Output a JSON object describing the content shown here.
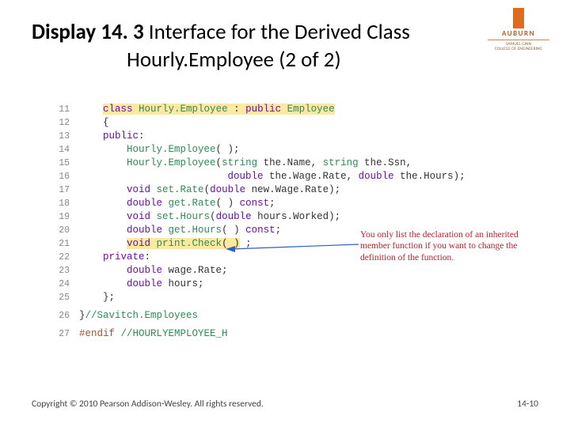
{
  "title": {
    "label": "Display 14. 3",
    "line1_rest": "  Interface for the Derived Class",
    "line2": "Hourly.Employee (2 of 2)"
  },
  "logo": {
    "name": "AUBURN",
    "sub1": "SAMUEL GINN",
    "sub2": "COLLEGE OF ENGINEERING"
  },
  "code": {
    "lines": [
      {
        "n": "11",
        "tokens": [
          {
            "t": "    ",
            "c": ""
          },
          {
            "t": "class",
            "c": "kw hl"
          },
          {
            "t": " ",
            "c": "hl"
          },
          {
            "t": "Hourly.Employee",
            "c": "ident hl"
          },
          {
            "t": " : ",
            "c": "hl sym"
          },
          {
            "t": "public",
            "c": "kw hl"
          },
          {
            "t": " ",
            "c": "hl"
          },
          {
            "t": "Employee",
            "c": "ident hl"
          }
        ]
      },
      {
        "n": "12",
        "tokens": [
          {
            "t": "    {",
            "c": "sym"
          }
        ]
      },
      {
        "n": "13",
        "tokens": [
          {
            "t": "    ",
            "c": ""
          },
          {
            "t": "public",
            "c": "kw"
          },
          {
            "t": ":",
            "c": "sym"
          }
        ]
      },
      {
        "n": "14",
        "tokens": [
          {
            "t": "        ",
            "c": ""
          },
          {
            "t": "Hourly.Employee",
            "c": "func"
          },
          {
            "t": "( );",
            "c": "sym"
          }
        ]
      },
      {
        "n": "15",
        "tokens": [
          {
            "t": "        ",
            "c": ""
          },
          {
            "t": "Hourly.Employee",
            "c": "func"
          },
          {
            "t": "(",
            "c": "sym"
          },
          {
            "t": "string",
            "c": "typegreen"
          },
          {
            "t": " the.Name, ",
            "c": "sym"
          },
          {
            "t": "string",
            "c": "typegreen"
          },
          {
            "t": " the.Ssn,",
            "c": "sym"
          }
        ]
      },
      {
        "n": "16",
        "tokens": [
          {
            "t": "                         ",
            "c": ""
          },
          {
            "t": "double",
            "c": "kw"
          },
          {
            "t": " the.Wage.Rate, ",
            "c": "sym"
          },
          {
            "t": "double",
            "c": "kw"
          },
          {
            "t": " the.Hours);",
            "c": "sym"
          }
        ]
      },
      {
        "n": "17",
        "tokens": [
          {
            "t": "        ",
            "c": ""
          },
          {
            "t": "void",
            "c": "kw"
          },
          {
            "t": " ",
            "c": ""
          },
          {
            "t": "set.Rate",
            "c": "func"
          },
          {
            "t": "(",
            "c": "sym"
          },
          {
            "t": "double",
            "c": "kw"
          },
          {
            "t": " new.Wage.Rate);",
            "c": "sym"
          }
        ]
      },
      {
        "n": "18",
        "tokens": [
          {
            "t": "        ",
            "c": ""
          },
          {
            "t": "double",
            "c": "kw"
          },
          {
            "t": " ",
            "c": ""
          },
          {
            "t": "get.Rate",
            "c": "func"
          },
          {
            "t": "( ) ",
            "c": "sym"
          },
          {
            "t": "const",
            "c": "kw"
          },
          {
            "t": ";",
            "c": "sym"
          }
        ]
      },
      {
        "n": "19",
        "tokens": [
          {
            "t": "        ",
            "c": ""
          },
          {
            "t": "void",
            "c": "kw"
          },
          {
            "t": " ",
            "c": ""
          },
          {
            "t": "set.Hours",
            "c": "func"
          },
          {
            "t": "(",
            "c": "sym"
          },
          {
            "t": "double",
            "c": "kw"
          },
          {
            "t": " hours.Worked);",
            "c": "sym"
          }
        ]
      },
      {
        "n": "20",
        "tokens": [
          {
            "t": "        ",
            "c": ""
          },
          {
            "t": "double",
            "c": "kw"
          },
          {
            "t": " ",
            "c": ""
          },
          {
            "t": "get.Hours",
            "c": "func"
          },
          {
            "t": "( ) ",
            "c": "sym"
          },
          {
            "t": "const",
            "c": "kw"
          },
          {
            "t": ";",
            "c": "sym"
          }
        ]
      },
      {
        "n": "21",
        "tokens": [
          {
            "t": "        ",
            "c": ""
          },
          {
            "t": "void",
            "c": "kw hl"
          },
          {
            "t": " ",
            "c": "hl"
          },
          {
            "t": "print.Check",
            "c": "func hl"
          },
          {
            "t": "( )",
            "c": "sym hl"
          },
          {
            "t": " ;",
            "c": "sym"
          }
        ]
      },
      {
        "n": "22",
        "tokens": [
          {
            "t": "    ",
            "c": ""
          },
          {
            "t": "private",
            "c": "kw"
          },
          {
            "t": ":",
            "c": "sym"
          }
        ]
      },
      {
        "n": "23",
        "tokens": [
          {
            "t": "        ",
            "c": ""
          },
          {
            "t": "double",
            "c": "kw"
          },
          {
            "t": " wage.Rate;",
            "c": "sym"
          }
        ]
      },
      {
        "n": "24",
        "tokens": [
          {
            "t": "        ",
            "c": ""
          },
          {
            "t": "double",
            "c": "kw"
          },
          {
            "t": " hours;",
            "c": "sym"
          }
        ]
      },
      {
        "n": "25",
        "tokens": [
          {
            "t": "    };",
            "c": "sym"
          }
        ]
      }
    ],
    "tail": [
      {
        "n": "26",
        "tokens": [
          {
            "t": "}",
            "c": "sym"
          },
          {
            "t": "//Savitch.Employees",
            "c": "cmt"
          }
        ]
      },
      {
        "n": "27",
        "tokens": [
          {
            "t": "#endif ",
            "c": "pre"
          },
          {
            "t": "//HOURLYEMPLOYEE_H",
            "c": "cmt"
          }
        ]
      }
    ]
  },
  "annotation": "You only list the declaration of an inherited member function if you want to change the definition of the function.",
  "footer": {
    "copyright": "Copyright © 2010 Pearson Addison-Wesley. All rights reserved.",
    "pagenum": "14-10"
  }
}
